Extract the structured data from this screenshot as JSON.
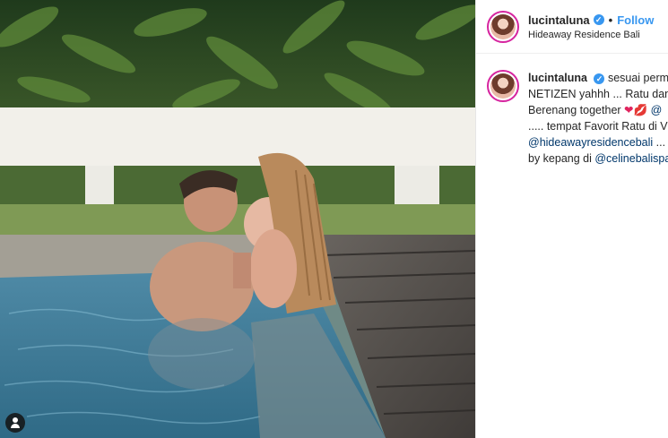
{
  "post": {
    "username": "lucintaluna",
    "follow_label": "Follow",
    "separator": "•",
    "location": "Hideaway Residence Bali"
  },
  "caption": {
    "username": "lucintaluna",
    "line1": "sesuai permin",
    "line2": "NETIZEN yahhh ... Ratu dan",
    "line3": "Berenang together",
    "line3_emoji": "❤💋",
    "line3_tail": "@",
    "line4": "..... tempat Favorit Ratu di Vi",
    "line5_mention": "@hideawayresidencebali",
    "line5_tail": " ... I",
    "line6_prefix": "by kepang di ",
    "line6_mention": "@celinebalispa"
  },
  "icons": {
    "verified": "verified-badge-icon",
    "user_tag": "user-tag-icon"
  },
  "colors": {
    "link": "#3897f0",
    "mention": "#00376b",
    "verified": "#3897f0"
  }
}
